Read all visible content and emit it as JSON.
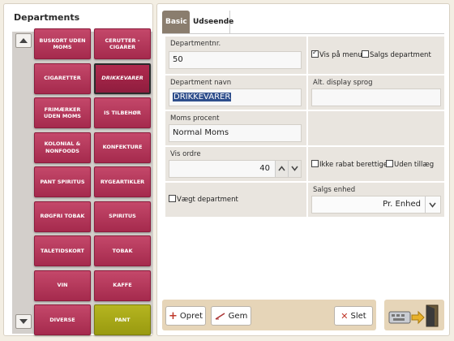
{
  "left": {
    "title": "Departments",
    "departments": [
      "BUSKORT UDEN MOMS",
      "CERUTTER - CIGARER",
      "CIGARETTER",
      "DRIKKEVARER",
      "FRIMÆRKER UDEN MOMS",
      "IS TILBEHØR",
      "KOLONIAL & NONFOODS",
      "KONFEKTURE",
      "PANT SPIRITUS",
      "RYGEARTIKLER",
      "RØGFRI TOBAK",
      "SPIRITUS",
      "TALETIDSKORT",
      "TOBAK",
      "VIN",
      "KAFFE",
      "DIVERSE",
      "PANT"
    ],
    "selected": "DRIKKEVARER"
  },
  "tabs": [
    "Basic",
    "Udseende"
  ],
  "form": {
    "department_nr_label": "Departmentnr.",
    "department_nr_value": "50",
    "vis_paa_menu_label": "Vis på menu",
    "salgs_department_label": "Salgs department",
    "department_navn_label": "Department navn",
    "department_navn_value": "DRIKKEVARER",
    "alt_display_label": "Alt. display sprog",
    "alt_display_value": "",
    "moms_label": "Moms procent",
    "moms_value": "Normal Moms",
    "vis_ordre_label": "Vis ordre",
    "vis_ordre_value": "40",
    "ikke_rabat_label": "Ikke rabat berettiget",
    "uden_tillaeg_label": "Uden tillæg",
    "vaegt_label": "Vægt department",
    "salgs_enhed_label": "Salgs enhed",
    "salgs_enhed_value": "Pr. Enhed"
  },
  "checkbox_state": {
    "vis_paa_menu": true,
    "salgs_department": false,
    "ikke_rabat": false,
    "uden_tillaeg": false,
    "vaegt": false
  },
  "buttons": {
    "opret": "Opret",
    "gem": "Gem",
    "slet": "Slet"
  },
  "colors": {
    "department_button": "#b3375a",
    "pant_button": "#a8a817",
    "active_tab": "#8a7d6e",
    "bottom_bar": "#e6d5b8"
  }
}
